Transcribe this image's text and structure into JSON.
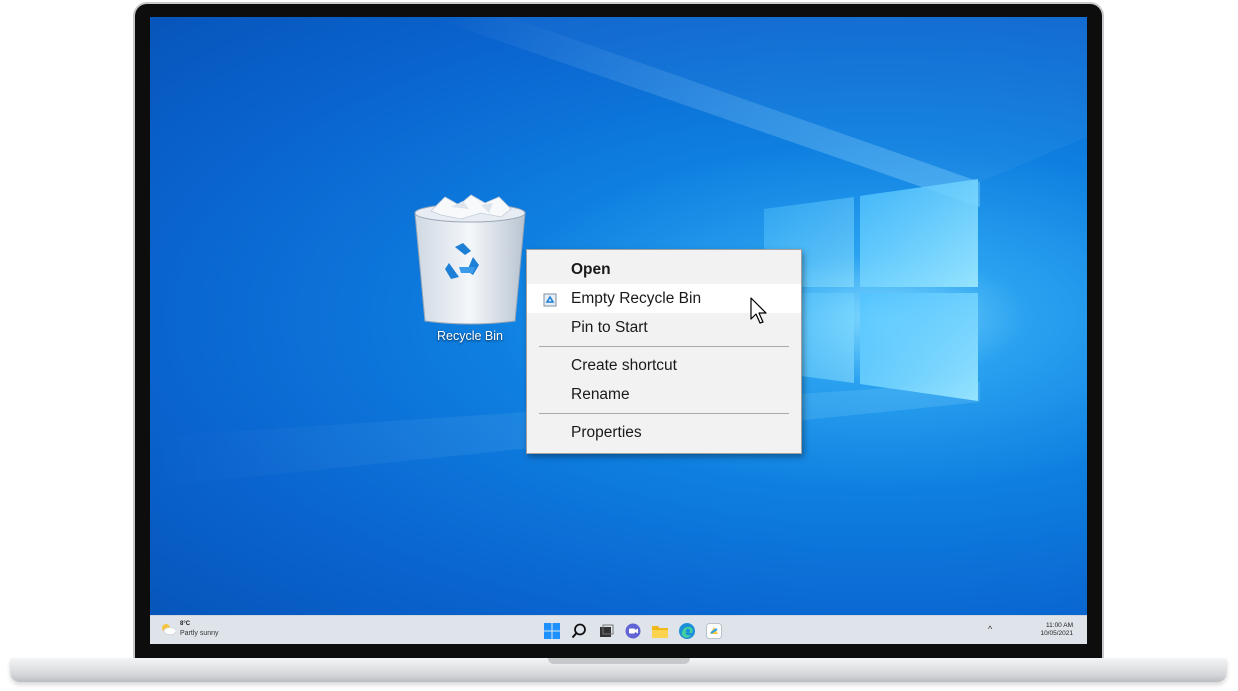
{
  "desktop": {
    "icons": [
      {
        "label": "Recycle Bin"
      }
    ]
  },
  "context_menu": {
    "items": [
      {
        "label": "Open",
        "bold": true
      },
      {
        "label": "Empty Recycle Bin",
        "icon": "recycle-bin-icon",
        "hovered": true
      },
      {
        "label": "Pin to Start"
      },
      {
        "label": "Create shortcut"
      },
      {
        "label": "Rename"
      },
      {
        "label": "Properties"
      }
    ]
  },
  "taskbar": {
    "weather": {
      "temp": "8°C",
      "desc": "Partly sunny",
      "icon": "partly-sunny-icon"
    },
    "apps": [
      "start-icon",
      "search-icon",
      "task-view-icon",
      "chat-icon",
      "file-explorer-icon",
      "edge-icon",
      "store-icon"
    ],
    "tray_chevron": "^",
    "clock": {
      "time": "11:00 AM",
      "date": "10/05/2021"
    }
  },
  "colors": {
    "wallpaper_blue": "#0a64cf",
    "menu_bg": "#f2f2f2",
    "taskbar_bg": "#dfe4ea"
  }
}
